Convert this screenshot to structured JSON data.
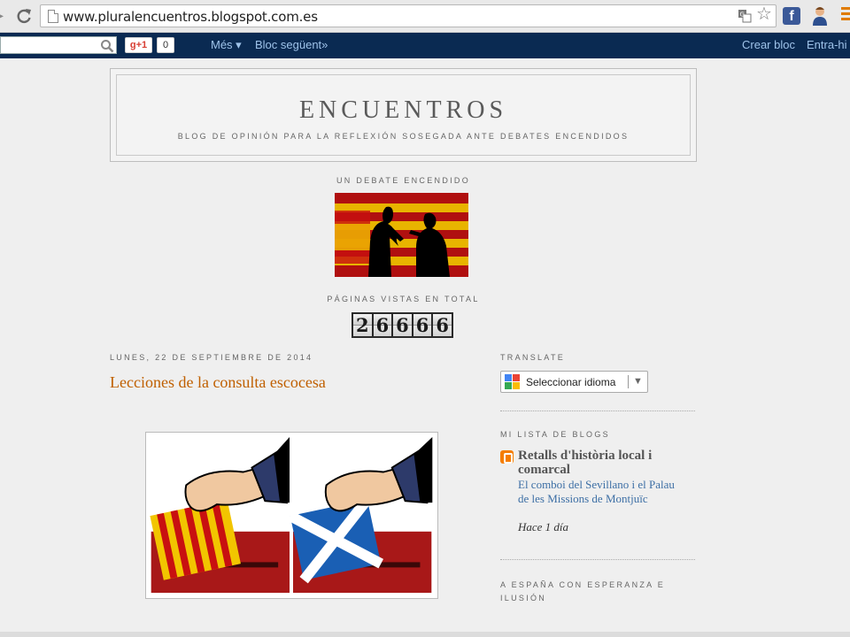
{
  "browser": {
    "url": "www.pluralencuentros.blogspot.com.es"
  },
  "navbar": {
    "gplus_label": "g+1",
    "gplus_count": "0",
    "more_label": "Més ▾",
    "next_blog_label": "Bloc següent»",
    "create_blog_label": "Crear bloc",
    "login_label": "Entra-hi"
  },
  "header": {
    "title": "ENCUENTROS",
    "description": "BLOG DE OPINIÓN PARA LA REFLEXIÓN SOSEGADA ANTE DEBATES ENCENDIDOS"
  },
  "widgets": {
    "debate_title": "UN DEBATE ENCENDIDO",
    "views_title": "PÁGINAS VISTAS EN TOTAL",
    "views_digits": [
      "2",
      "6",
      "6",
      "6",
      "6"
    ]
  },
  "post": {
    "date": "LUNES, 22 DE SEPTIEMBRE DE 2014",
    "title": "Lecciones de la consulta escocesa"
  },
  "sidebar": {
    "translate_title": "TRANSLATE",
    "translate_select": "Seleccionar idioma",
    "bloglist_title": "MI LISTA DE BLOGS",
    "blog_name": "Retalls d'història local i comarcal",
    "blog_post": "El comboi del Sevillano i el Palau de les Missions de Montjuïc",
    "blog_time": "Hace 1 día",
    "next_widget_title": "A ESPAÑA CON ESPERANZA E ILUSIÓN"
  },
  "colors": {
    "navbar_bg": "#0a2a52",
    "post_title": "#c06000",
    "link": "#3d6fa5",
    "blogger_orange": "#f57d00"
  }
}
